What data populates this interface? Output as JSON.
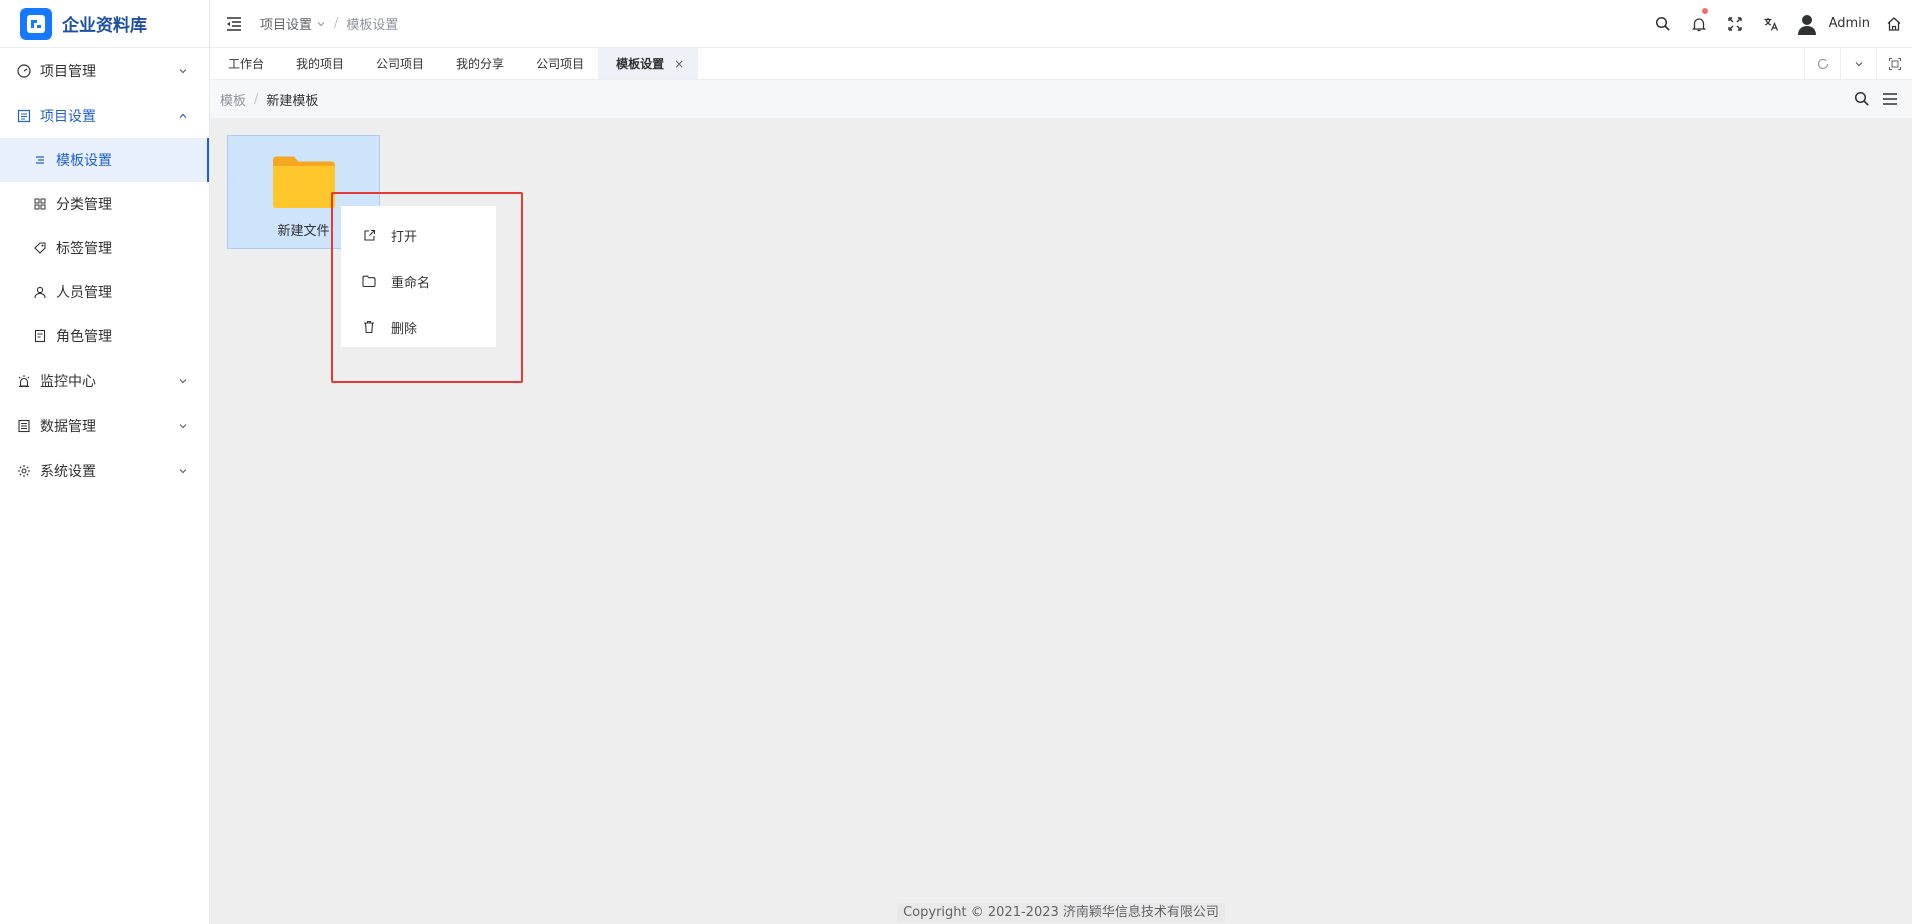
{
  "app": {
    "title": "企业资料库",
    "brand_color": "#1677ff",
    "accent_color": "#1f5fcc"
  },
  "sidebar": {
    "items": [
      {
        "label": "项目管理",
        "icon": "dashboard-icon",
        "expanded": false
      },
      {
        "label": "项目设置",
        "icon": "document-list-icon",
        "expanded": true,
        "children": [
          {
            "label": "模板设置",
            "icon": "align-lines-icon",
            "active": true
          },
          {
            "label": "分类管理",
            "icon": "grid-icon",
            "active": false
          },
          {
            "label": "标签管理",
            "icon": "tag-icon",
            "active": false
          },
          {
            "label": "人员管理",
            "icon": "user-icon",
            "active": false
          },
          {
            "label": "角色管理",
            "icon": "role-icon",
            "active": false
          }
        ]
      },
      {
        "label": "监控中心",
        "icon": "alarm-icon",
        "expanded": false
      },
      {
        "label": "数据管理",
        "icon": "database-icon",
        "expanded": false
      },
      {
        "label": "系统设置",
        "icon": "gear-icon",
        "expanded": false
      }
    ]
  },
  "header": {
    "breadcrumb_parent": "项目设置",
    "breadcrumb_current": "模板设置",
    "user_name": "Admin",
    "notification_dot_color": "#f56c6c"
  },
  "tabs": [
    {
      "label": "工作台",
      "active": false
    },
    {
      "label": "我的项目",
      "active": false
    },
    {
      "label": "公司项目",
      "active": false
    },
    {
      "label": "我的分享",
      "active": false
    },
    {
      "label": "公司项目",
      "active": false
    },
    {
      "label": "模板设置",
      "active": true,
      "closable": true,
      "close_glyph": "×"
    }
  ],
  "subbar": {
    "crumb_parent": "模板",
    "crumb_current": "新建模板"
  },
  "main": {
    "folder": {
      "label": "新建文件",
      "icon": "folder-icon"
    },
    "context_menu": {
      "items": [
        {
          "label": "打开",
          "icon": "external-link-icon"
        },
        {
          "label": "重命名",
          "icon": "folder-outline-icon"
        },
        {
          "label": "删除",
          "icon": "trash-icon"
        }
      ],
      "highlight_color": "#e53935"
    }
  },
  "footer": {
    "text": "Copyright © 2021-2023 济南颖华信息技术有限公司"
  }
}
